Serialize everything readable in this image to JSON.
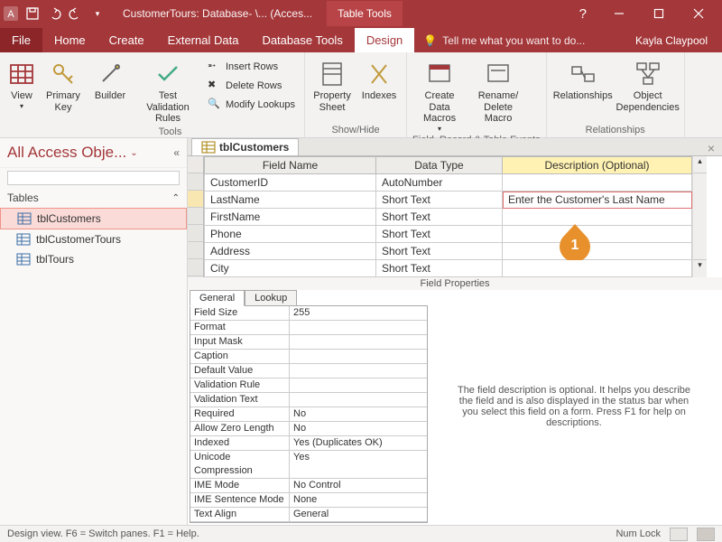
{
  "titlebar": {
    "title": "CustomerTours: Database- \\... (Acces...",
    "tooltab": "Table Tools",
    "help": "?"
  },
  "menu": {
    "file": "File",
    "home": "Home",
    "create": "Create",
    "external": "External Data",
    "dbtools": "Database Tools",
    "design": "Design",
    "tellme": "Tell me what you want to do...",
    "user": "Kayla Claypool"
  },
  "ribbon": {
    "view": "View",
    "primarykey": "Primary\nKey",
    "builder": "Builder",
    "testval": "Test Validation\nRules",
    "insertrows": "Insert Rows",
    "deleterows": "Delete Rows",
    "modifylookups": "Modify Lookups",
    "tools_lbl": "Tools",
    "propsheet": "Property\nSheet",
    "indexes": "Indexes",
    "showhide_lbl": "Show/Hide",
    "datamacros": "Create Data\nMacros",
    "renamedelete": "Rename/\nDelete Macro",
    "events_lbl": "Field, Record & Table Events",
    "relationships": "Relationships",
    "objdeps": "Object\nDependencies",
    "rel_lbl": "Relationships"
  },
  "nav": {
    "header": "All Access Obje...",
    "category": "Tables",
    "items": [
      "tblCustomers",
      "tblCustomerTours",
      "tblTours"
    ]
  },
  "doc": {
    "tab": "tblCustomers",
    "cols": {
      "fn": "Field Name",
      "dt": "Data Type",
      "desc": "Description (Optional)"
    },
    "rows": [
      {
        "fn": "CustomerID",
        "dt": "AutoNumber",
        "desc": ""
      },
      {
        "fn": "LastName",
        "dt": "Short Text",
        "desc": "Enter the Customer's Last Name"
      },
      {
        "fn": "FirstName",
        "dt": "Short Text",
        "desc": ""
      },
      {
        "fn": "Phone",
        "dt": "Short Text",
        "desc": ""
      },
      {
        "fn": "Address",
        "dt": "Short Text",
        "desc": ""
      },
      {
        "fn": "City",
        "dt": "Short Text",
        "desc": ""
      }
    ],
    "fp_label": "Field Properties"
  },
  "fp": {
    "tabs": {
      "general": "General",
      "lookup": "Lookup"
    },
    "rows": [
      {
        "k": "Field Size",
        "v": "255"
      },
      {
        "k": "Format",
        "v": ""
      },
      {
        "k": "Input Mask",
        "v": ""
      },
      {
        "k": "Caption",
        "v": ""
      },
      {
        "k": "Default Value",
        "v": ""
      },
      {
        "k": "Validation Rule",
        "v": ""
      },
      {
        "k": "Validation Text",
        "v": ""
      },
      {
        "k": "Required",
        "v": "No"
      },
      {
        "k": "Allow Zero Length",
        "v": "No"
      },
      {
        "k": "Indexed",
        "v": "Yes (Duplicates OK)"
      },
      {
        "k": "Unicode Compression",
        "v": "Yes"
      },
      {
        "k": "IME Mode",
        "v": "No Control"
      },
      {
        "k": "IME Sentence Mode",
        "v": "None"
      },
      {
        "k": "Text Align",
        "v": "General"
      }
    ],
    "help": "The field description is optional. It helps you describe the field and is also displayed in the status bar when you select this field on a form. Press F1 for help on descriptions."
  },
  "status": {
    "left": "Design view.  F6 = Switch panes.  F1 = Help.",
    "numlock": "Num Lock"
  },
  "marker": "1"
}
